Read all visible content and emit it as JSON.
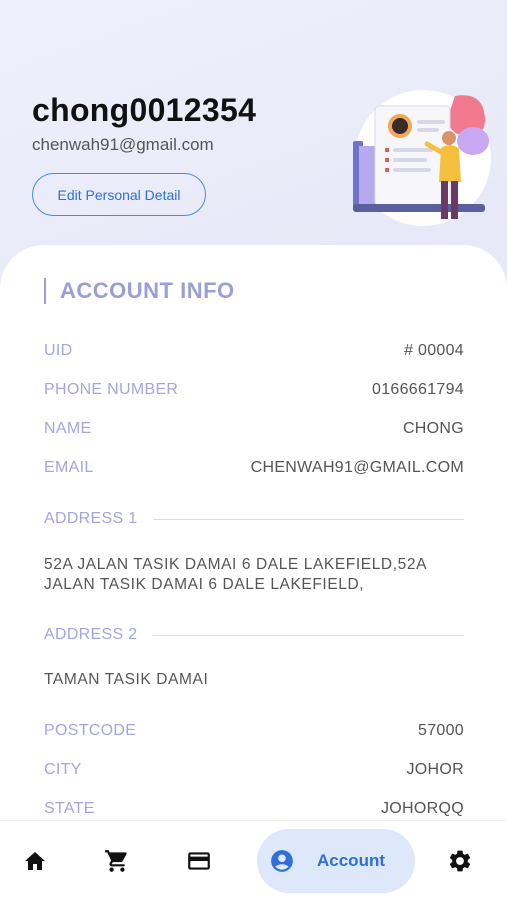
{
  "profile": {
    "username": "chong0012354",
    "email": "chenwah91@gmail.com",
    "edit_label": "Edit Personal Detail"
  },
  "account": {
    "title": "ACCOUNT INFO",
    "rows": [
      {
        "label": "UID",
        "value": "# 00004"
      },
      {
        "label": "PHONE NUMBER",
        "value": "0166661794"
      },
      {
        "label": "NAME",
        "value": "CHONG"
      },
      {
        "label": "EMAIL",
        "value": "CHENWAH91@GMAIL.COM"
      }
    ],
    "address1_label": "ADDRESS 1",
    "address1_line1": "52A JALAN TASIK DAMAI 6  DALE  LAKEFIELD,52A",
    "address1_line2": "JALAN TASIK DAMAI 6  DALE  LAKEFIELD,",
    "address2_label": "ADDRESS 2",
    "address2_value": "TAMAN TASIK DAMAI",
    "rows2": [
      {
        "label": "POSTCODE",
        "value": "57000"
      },
      {
        "label": "CITY",
        "value": "JOHOR"
      },
      {
        "label": "STATE",
        "value": "JOHORQQ"
      }
    ]
  },
  "nav": {
    "items": [
      {
        "icon": "home-icon"
      },
      {
        "icon": "cart-icon"
      },
      {
        "icon": "card-icon"
      },
      {
        "icon": "account-icon",
        "label": "Account"
      },
      {
        "icon": "gear-icon"
      }
    ]
  },
  "colors": {
    "accent": "#2f6fd6",
    "label": "#a3a6dd",
    "nav_active_bg": "#dde8fb"
  }
}
